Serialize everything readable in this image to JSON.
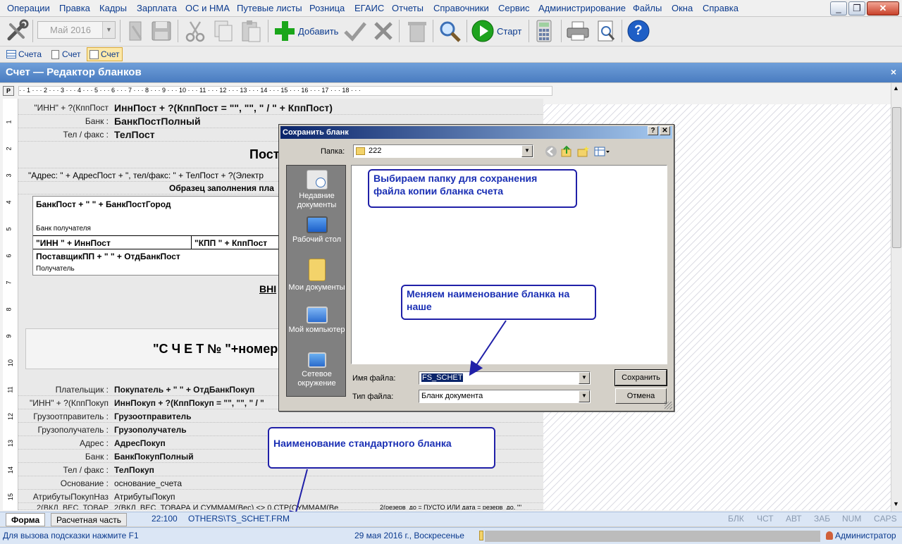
{
  "menu": [
    "Операции",
    "Правка",
    "Кадры",
    "Зарплата",
    "ОС и НМА",
    "Путевые листы",
    "Розница",
    "ЕГАИС",
    "Отчеты",
    "Справочники",
    "Сервис",
    "Администрирование",
    "Файлы",
    "Окна",
    "Справка"
  ],
  "window_buttons": {
    "minimize": "_",
    "restore": "❐",
    "close": "✕"
  },
  "toolbar": {
    "month": "Май 2016",
    "add_label": "Добавить",
    "start_label": "Старт",
    "help_label": "?"
  },
  "subtabs": [
    "Счета",
    "Счет",
    "Счет"
  ],
  "window_title": "Счет — Редактор бланков",
  "window_close": "×",
  "ruler": {
    "p": "Р",
    "marks": "· · 1 · · · 2 · · · 3 · · · 4 · · · 5 · · · 6 · · · 7 · · · 8 · · · 9 · · · 10 · · · 11 · · · 12 · · · 13 · · · 14 · · · 15 · · · 16 · · · 17 · · · 18 · · ·",
    "left": [
      "1",
      "2",
      "3",
      "4",
      "5",
      "6",
      "7",
      "8",
      "9",
      "10",
      "11",
      "12",
      "13",
      "14",
      "15"
    ]
  },
  "form": {
    "top_rows": [
      {
        "label": "\"ИНН\" + ?(КппПост",
        "value": "ИннПост + ?(КппПост = \"\", \"\", \" / \" + КппПост)"
      },
      {
        "label": "Банк :",
        "value": "БанкПостПолный"
      },
      {
        "label": "Тел / факс :",
        "value": "ТелПост"
      }
    ],
    "post_header": "Пост",
    "address_line": "\"Адрес: \" + АдресПост + \", тел/факс: \" + ТелПост + ?(Электр",
    "sample_title": "Образец заполнения пла",
    "bank_post": "БанкПост + \" \" + БанкПостГород",
    "bank_receiver": "Банк получателя",
    "inn_cell": "\"ИНН \" + ИннПост",
    "kpp_cell": "\"КПП \" + КппПост",
    "supplier": "ПоставщикПП + \" \" + ОтдБанкПост",
    "receiver": "Получатель",
    "vni": "ВНІ",
    "invoice_title": "\"С Ч Е Т  №  \"+номер",
    "bottom_rows": [
      {
        "label": "Плательщик :",
        "value": "Покупатель + \"  \" + ОтдБанкПокуп"
      },
      {
        "label": "\"ИНН\" + ?(КппПокуп",
        "value": "ИннПокуп + ?(КппПокуп = \"\", \"\", \" / \""
      },
      {
        "label": "Грузоотправитель :",
        "value": "Грузоотправитель"
      },
      {
        "label": "Грузополучатель :",
        "value": "Грузополучатель"
      },
      {
        "label": "Адрес :",
        "value": "АдресПокуп"
      },
      {
        "label": "Банк :",
        "value": "БанкПокупПолный"
      },
      {
        "label": "Тел / факс :",
        "value": "ТелПокуп"
      },
      {
        "label": "Основание :",
        "value": "основание_счета"
      },
      {
        "label": "АтрибутыПокупНаз",
        "value": "АтрибутыПокуп"
      },
      {
        "label": "2(ВКЛ_ВЕС_ТОВАР",
        "value": "2(ВКЛ_ВЕС_ТОВАРА И СУММАМ(Вес) <> 0,СТР(СУММАМ(Ве"
      }
    ],
    "tiny_right": "2(резерв_до = ПУСТО ИЛИ дата = резерв_до, \"\""
  },
  "dialog": {
    "title": "Сохранить бланк",
    "help": "?",
    "close": "✕",
    "folder_label": "Папка:",
    "folder_value": "222",
    "places": [
      {
        "label": "Недавние документы",
        "icon": "recent-documents-icon"
      },
      {
        "label": "Рабочий стол",
        "icon": "desktop-icon"
      },
      {
        "label": "Мои документы",
        "icon": "my-documents-icon"
      },
      {
        "label": "Мой компьютер",
        "icon": "my-computer-icon"
      },
      {
        "label": "Сетевое окружение",
        "icon": "network-icon"
      }
    ],
    "filename_label": "Имя файла:",
    "filename_value": "FS_SCHET",
    "filetype_label": "Тип файла:",
    "filetype_value": "Бланк документа",
    "save_button": "Сохранить",
    "cancel_button": "Отмена"
  },
  "callouts": {
    "folder": "Выбираем папку для сохранения файла копии бланка счета",
    "rename": "Меняем наименование бланка на наше",
    "standard": "Наименование стандартного бланка"
  },
  "bottom": {
    "tab_form": "Форма",
    "tab_calc": "Расчетная часть",
    "position": "22:100",
    "file": "OTHERS\\TS_SCHET.FRM",
    "indicators": [
      "БЛК",
      "ЧСТ",
      "АВТ",
      "ЗАБ",
      "NUM",
      "CAPS"
    ]
  },
  "status": {
    "hint": "Для вызова подсказки нажмите F1",
    "date": "29 мая 2016 г., Воскресенье",
    "user": "Администратор"
  },
  "colors": {
    "accent": "#4a7cc0",
    "callout_border": "#2020a8",
    "callout_text": "#1a2fb4",
    "dialog_title": "#0a246a"
  }
}
